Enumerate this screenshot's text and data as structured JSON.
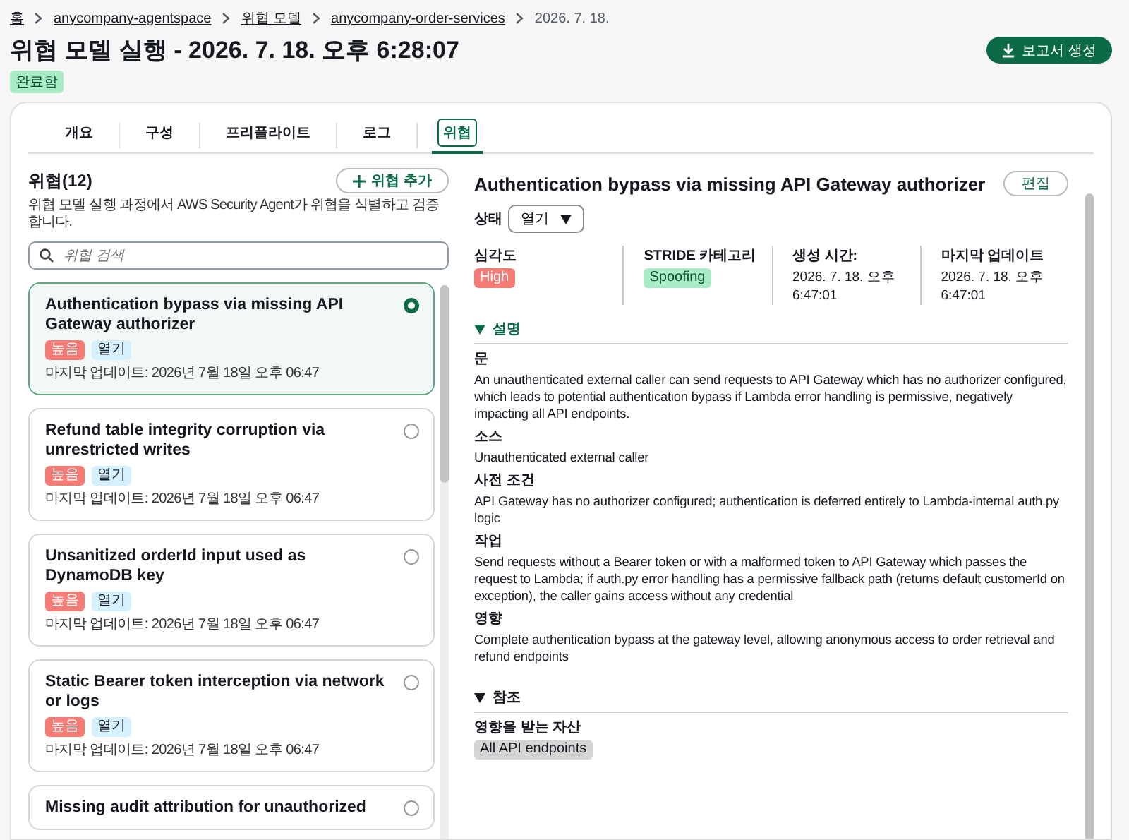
{
  "breadcrumbs": [
    {
      "label": "홈",
      "kind": "link"
    },
    {
      "label": "anycompany-agentspace",
      "kind": "link"
    },
    {
      "label": "위협 모델",
      "kind": "link"
    },
    {
      "label": "anycompany-order-services",
      "kind": "link"
    },
    {
      "label": "2026. 7. 18.",
      "kind": "current"
    }
  ],
  "title": "위협 모델 실행 - 2026. 7. 18. 오후 6:28:07",
  "status_badge": "완료함",
  "report_button": "보고서 생성",
  "tabs": [
    {
      "label": "개요",
      "selected": false
    },
    {
      "label": "구성",
      "selected": false
    },
    {
      "label": "프리플라이트",
      "selected": false
    },
    {
      "label": "로그",
      "selected": false
    },
    {
      "label": "위협",
      "selected": true
    }
  ],
  "threats": {
    "heading": "위협(12)",
    "add_button": "위협 추가",
    "description": "위협 모델 실행 과정에서 AWS Security Agent가 위협을 식별하고 검증합니다.",
    "search": {
      "placeholder": "위협 검색"
    },
    "items": [
      {
        "title": "Authentication bypass via missing API Gateway authorizer",
        "selected": true,
        "severity": "높음",
        "status": "열기",
        "updated": "마지막 업데이트: 2026년 7월 18일 오후 06:47"
      },
      {
        "title": "Refund table integrity corruption via unrestricted writes",
        "selected": false,
        "severity": "높음",
        "status": "열기",
        "updated": "마지막 업데이트: 2026년 7월 18일 오후 06:47"
      },
      {
        "title": "Unsanitized orderId input used as DynamoDB key",
        "selected": false,
        "severity": "높음",
        "status": "열기",
        "updated": "마지막 업데이트: 2026년 7월 18일 오후 06:47"
      },
      {
        "title": "Static Bearer token interception via network or logs",
        "selected": false,
        "severity": "높음",
        "status": "열기",
        "updated": "마지막 업데이트: 2026년 7월 18일 오후 06:47"
      },
      {
        "title": "Missing audit attribution for unauthorized",
        "selected": false
      }
    ]
  },
  "detail": {
    "title": "Authentication bypass via missing API Gateway authorizer",
    "edit_button": "편집",
    "status_label": "상태",
    "status_value": "열기",
    "meta": [
      {
        "label": "심각도",
        "kind": "severity",
        "value": "High"
      },
      {
        "label": "STRIDE 카테고리",
        "kind": "category",
        "value": "Spoofing"
      },
      {
        "label": "생성 시간:",
        "kind": "text",
        "value": "2026. 7. 18. 오후 6:47:01"
      },
      {
        "label": "마지막 업데이트",
        "kind": "text",
        "value": "2026. 7. 18. 오후 6:47:01"
      }
    ],
    "sections": [
      {
        "title": "설명",
        "expanded": true,
        "accent": true,
        "fields": [
          {
            "label": "문",
            "text": "An unauthenticated external caller can send requests to API Gateway which has no authorizer configured, which leads to potential authentication bypass if Lambda error handling is permissive, negatively impacting all API endpoints."
          },
          {
            "label": "소스",
            "text": "Unauthenticated external caller"
          },
          {
            "label": "사전 조건",
            "text": "API Gateway has no authorizer configured; authentication is deferred entirely to Lambda-internal auth.py logic"
          },
          {
            "label": "작업",
            "text": "Send requests without a Bearer token or with a malformed token to API Gateway which passes the request to Lambda; if auth.py error handling has a permissive fallback path (returns default customerId on exception), the caller gains access without any credential"
          },
          {
            "label": "영향",
            "text": "Complete authentication bypass at the gateway level, allowing anonymous access to order retrieval and refund endpoints"
          }
        ]
      },
      {
        "title": "참조",
        "expanded": true,
        "accent": false,
        "fields": [
          {
            "label": "영향을 받는 자산",
            "tags": [
              "All API endpoints"
            ]
          }
        ]
      }
    ]
  }
}
